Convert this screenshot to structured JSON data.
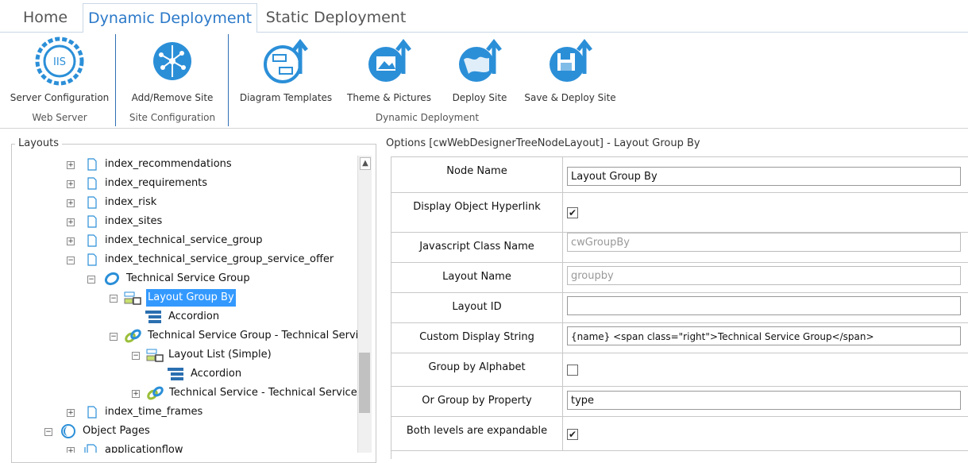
{
  "tabs": [
    {
      "label": "Home"
    },
    {
      "label": "Dynamic Deployment"
    },
    {
      "label": "Static Deployment"
    }
  ],
  "ribbon": {
    "buttons": [
      {
        "label": "Server Configuration",
        "icon": "iis-server-icon"
      },
      {
        "label": "Add/Remove Site",
        "icon": "network-globe-icon"
      },
      {
        "label": "Diagram Templates",
        "icon": "diagram-upload-icon"
      },
      {
        "label": "Theme & Pictures",
        "icon": "picture-upload-icon"
      },
      {
        "label": "Deploy Site",
        "icon": "globe-upload-icon"
      },
      {
        "label": "Save & Deploy Site",
        "icon": "save-globe-upload-icon"
      }
    ],
    "groups": [
      {
        "label": "Web Server"
      },
      {
        "label": "Site Configuration"
      },
      {
        "label": "Dynamic Deployment"
      }
    ]
  },
  "layouts": {
    "title": "Layouts",
    "nodes": [
      {
        "label": "index_recommendations"
      },
      {
        "label": "index_requirements"
      },
      {
        "label": "index_risk"
      },
      {
        "label": "index_sites"
      },
      {
        "label": "index_technical_service_group"
      },
      {
        "label": "index_technical_service_group_service_offer"
      },
      {
        "label": "Technical Service Group"
      },
      {
        "label": "Layout Group By"
      },
      {
        "label": "Accordion"
      },
      {
        "label": "Technical Service Group - Technical Service"
      },
      {
        "label": "Layout List (Simple)"
      },
      {
        "label": "Accordion"
      },
      {
        "label": "Technical Service - Technical Service Of"
      },
      {
        "label": "index_time_frames"
      },
      {
        "label": "Object Pages"
      },
      {
        "label": "applicationflow"
      }
    ]
  },
  "options": {
    "title": "Options [cwWebDesignerTreeNodeLayout] - Layout Group By",
    "rows": [
      {
        "label": "Node Name",
        "type": "text",
        "value": "Layout Group By"
      },
      {
        "label": "Display Object Hyperlink",
        "type": "checkbox",
        "checked": true
      },
      {
        "label": "Javascript Class Name",
        "type": "readonly",
        "value": "cwGroupBy"
      },
      {
        "label": "Layout Name",
        "type": "readonly",
        "value": "groupby"
      },
      {
        "label": "Layout ID",
        "type": "text",
        "value": ""
      },
      {
        "label": "Custom Display String",
        "type": "text",
        "value": "{name} <span class=\"right\">Technical Service Group</span>"
      },
      {
        "label": "Group by Alphabet",
        "type": "checkbox",
        "checked": false
      },
      {
        "label": "Or Group by Property",
        "type": "text",
        "value": "type"
      },
      {
        "label": "Both levels are expandable",
        "type": "checkbox",
        "checked": true
      }
    ]
  },
  "colors": {
    "accent": "#2b79c9",
    "selection": "#3399ff"
  }
}
